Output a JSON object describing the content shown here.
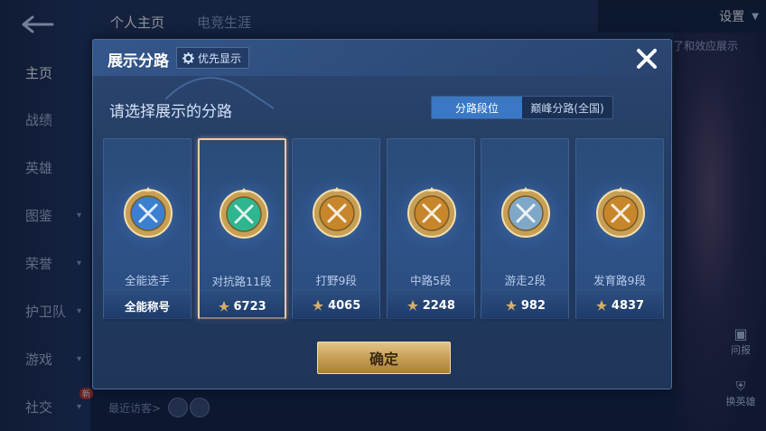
{
  "sidebar": {
    "items": [
      {
        "label": "主页",
        "active": true,
        "chevron": false
      },
      {
        "label": "战绩",
        "active": false,
        "chevron": false
      },
      {
        "label": "英雄",
        "active": false,
        "chevron": false
      },
      {
        "label": "图鉴",
        "active": false,
        "chevron": true
      },
      {
        "label": "荣誉",
        "active": false,
        "chevron": true
      },
      {
        "label": "护卫队",
        "active": false,
        "chevron": true
      },
      {
        "label": "游戏",
        "active": false,
        "chevron": true
      },
      {
        "label": "社交",
        "active": false,
        "chevron": true
      }
    ],
    "new_badge": "新"
  },
  "top_tabs": [
    {
      "label": "个人主页",
      "active": true
    },
    {
      "label": "电竞生涯",
      "active": false
    }
  ],
  "settings": {
    "label": "设置"
  },
  "background": {
    "right_text": "了和效应展示",
    "report_label": "问报",
    "switch_hero_label": "换英雄",
    "recent_visitors_label": "最近访客>"
  },
  "modal": {
    "title": "展示分路",
    "priority_button": "优先显示",
    "subtitle": "请选择展示的分路",
    "toggle": [
      {
        "label": "分路段位",
        "active": true
      },
      {
        "label": "巅峰分路(全国)",
        "active": false
      }
    ],
    "cards": [
      {
        "rank_name": "全能选手",
        "score": "全能称号",
        "has_score_icon": false,
        "selected": false,
        "emblem": "allround-emblem-icon",
        "color": "#3a7fd0"
      },
      {
        "rank_name": "对抗路11段",
        "score": "6723",
        "has_score_icon": true,
        "selected": true,
        "emblem": "clash-lane-emblem-icon",
        "color": "#2fb58f"
      },
      {
        "rank_name": "打野9段",
        "score": "4065",
        "has_score_icon": true,
        "selected": false,
        "emblem": "jungle-emblem-icon",
        "color": "#c8862a"
      },
      {
        "rank_name": "中路5段",
        "score": "2248",
        "has_score_icon": true,
        "selected": false,
        "emblem": "mid-lane-emblem-icon",
        "color": "#c8862a"
      },
      {
        "rank_name": "游走2段",
        "score": "982",
        "has_score_icon": true,
        "selected": false,
        "emblem": "roam-emblem-icon",
        "color": "#7fa8c8"
      },
      {
        "rank_name": "发育路9段",
        "score": "4837",
        "has_score_icon": true,
        "selected": false,
        "emblem": "farm-lane-emblem-icon",
        "color": "#c8862a"
      }
    ],
    "confirm_label": "确定"
  },
  "colors": {
    "accent_blue": "#3a78c5",
    "gold": "#c79f55",
    "selected_border": "#f2c9a2"
  }
}
